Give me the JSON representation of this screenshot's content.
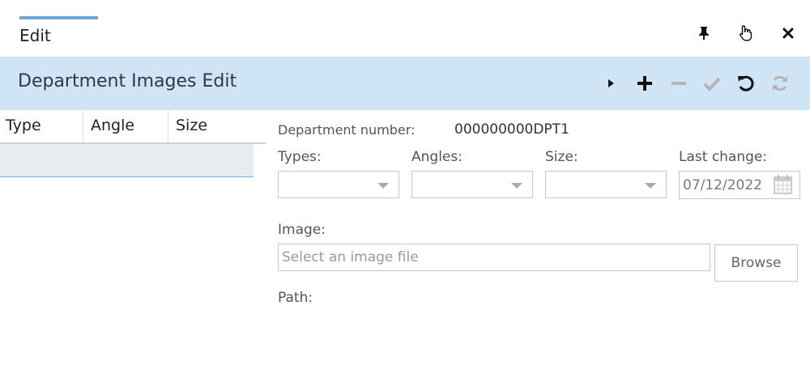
{
  "tab": {
    "label": "Edit"
  },
  "window_buttons": [
    "pin-icon",
    "pointer-hand-icon",
    "close-icon"
  ],
  "header": {
    "title": "Department Images Edit"
  },
  "toolbar": [
    "play-icon",
    "plus-icon",
    "minus-icon",
    "check-icon",
    "undo-icon",
    "refresh-icon"
  ],
  "grid": {
    "columns": [
      "Type",
      "Angle",
      "Size"
    ]
  },
  "form": {
    "department_number_label": "Department number:",
    "department_number_value": "000000000DPT1",
    "types_label": "Types:",
    "angles_label": "Angles:",
    "size_label": "Size:",
    "last_change_label": "Last change:",
    "last_change_value": "07/12/2022",
    "image_label": "Image:",
    "image_placeholder": "Select an image file",
    "browse_label": "Browse",
    "path_label": "Path:"
  },
  "colors": {
    "header_bg": "#cfe4f5",
    "tab_accent": "#6fa8d8",
    "row_bg": "#e8ecf0",
    "disabled": "#b5b5b5"
  }
}
